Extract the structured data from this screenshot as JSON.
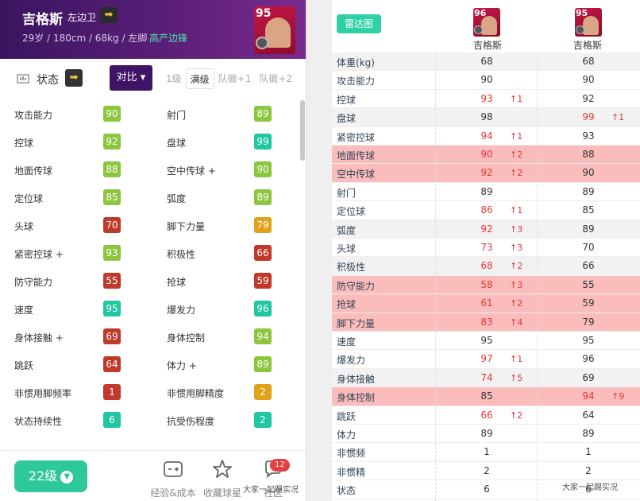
{
  "left": {
    "player_name": "吉格斯",
    "position": "左边卫",
    "info": "29岁 / 180cm / 68kg / 左脚",
    "play_style": "高产边锋",
    "card_rating": "95",
    "status_label": "状态",
    "compare_label": "对比",
    "level_tabs": [
      "1级",
      "满级",
      "队徽+1",
      "队徽+2"
    ],
    "stats": [
      {
        "label": "攻击能力",
        "value": "90",
        "color": "#8cc63f"
      },
      {
        "label": "射门",
        "value": "89",
        "color": "#8cc63f"
      },
      {
        "label": "控球",
        "value": "92",
        "color": "#8cc63f"
      },
      {
        "label": "盘球",
        "value": "99",
        "color": "#20c7a0"
      },
      {
        "label": "地面传球",
        "value": "88",
        "color": "#8cc63f"
      },
      {
        "label": "空中传球 +",
        "value": "90",
        "color": "#8cc63f"
      },
      {
        "label": "定位球",
        "value": "85",
        "color": "#8cc63f"
      },
      {
        "label": "弧度",
        "value": "89",
        "color": "#8cc63f"
      },
      {
        "label": "头球",
        "value": "70",
        "color": "#c0392b"
      },
      {
        "label": "脚下力量",
        "value": "79",
        "color": "#e2a11a"
      },
      {
        "label": "紧密控球 +",
        "value": "93",
        "color": "#8cc63f"
      },
      {
        "label": "积极性",
        "value": "66",
        "color": "#c0392b"
      },
      {
        "label": "防守能力",
        "value": "55",
        "color": "#c0392b"
      },
      {
        "label": "抢球",
        "value": "59",
        "color": "#c0392b"
      },
      {
        "label": "速度",
        "value": "95",
        "color": "#20c7a0"
      },
      {
        "label": "爆发力",
        "value": "96",
        "color": "#20c7a0"
      },
      {
        "label": "身体接触 +",
        "value": "69",
        "color": "#c0392b"
      },
      {
        "label": "身体控制",
        "value": "94",
        "color": "#8cc63f"
      },
      {
        "label": "跳跃",
        "value": "64",
        "color": "#c0392b"
      },
      {
        "label": "体力 +",
        "value": "89",
        "color": "#8cc63f"
      },
      {
        "label": "非惯用脚频率",
        "value": "1",
        "color": "#c0392b"
      },
      {
        "label": "非惯用脚精度",
        "value": "2",
        "color": "#e2a11a"
      },
      {
        "label": "状态持续性",
        "value": "6",
        "color": "#20c7a0"
      },
      {
        "label": "抗受伤程度",
        "value": "2",
        "color": "#20c7a0"
      }
    ],
    "level_button": "22级",
    "nav": [
      {
        "label": "经验&成本",
        "icon": "exp-cost-icon"
      },
      {
        "label": "收藏球星",
        "icon": "star-icon"
      },
      {
        "label": "社区",
        "icon": "chat-icon"
      }
    ],
    "notification_count": "12",
    "watermark": "大家一起踢实况"
  },
  "right": {
    "radar_label": "雷达图",
    "players": [
      {
        "name": "吉格斯",
        "rating": "96"
      },
      {
        "name": "吉格斯",
        "rating": "95"
      }
    ],
    "rows": [
      {
        "label": "体重(kg)",
        "v1": "68",
        "d1": "",
        "v2": "68",
        "d2": "",
        "style": "alt",
        "red1": false,
        "red2": false
      },
      {
        "label": "攻击能力",
        "v1": "90",
        "d1": "",
        "v2": "90",
        "d2": "",
        "style": "",
        "red1": false,
        "red2": false
      },
      {
        "label": "控球",
        "v1": "93",
        "d1": "↑1",
        "v2": "92",
        "d2": "",
        "style": "",
        "red1": true,
        "red2": false
      },
      {
        "label": "盘球",
        "v1": "98",
        "d1": "",
        "v2": "99",
        "d2": "↑1",
        "style": "alt",
        "red1": false,
        "red2": true
      },
      {
        "label": "紧密控球",
        "v1": "94",
        "d1": "↑1",
        "v2": "93",
        "d2": "",
        "style": "",
        "red1": true,
        "red2": false
      },
      {
        "label": "地面传球",
        "v1": "90",
        "d1": "↑2",
        "v2": "88",
        "d2": "",
        "style": "hl",
        "red1": true,
        "red2": false
      },
      {
        "label": "空中传球",
        "v1": "92",
        "d1": "↑2",
        "v2": "90",
        "d2": "",
        "style": "hl",
        "red1": true,
        "red2": false
      },
      {
        "label": "射门",
        "v1": "89",
        "d1": "",
        "v2": "89",
        "d2": "",
        "style": "",
        "red1": false,
        "red2": false
      },
      {
        "label": "定位球",
        "v1": "86",
        "d1": "↑1",
        "v2": "85",
        "d2": "",
        "style": "",
        "red1": true,
        "red2": false
      },
      {
        "label": "弧度",
        "v1": "92",
        "d1": "↑3",
        "v2": "89",
        "d2": "",
        "style": "alt",
        "red1": true,
        "red2": false
      },
      {
        "label": "头球",
        "v1": "73",
        "d1": "↑3",
        "v2": "70",
        "d2": "",
        "style": "",
        "red1": true,
        "red2": false
      },
      {
        "label": "积极性",
        "v1": "68",
        "d1": "↑2",
        "v2": "66",
        "d2": "",
        "style": "alt",
        "red1": true,
        "red2": false
      },
      {
        "label": "防守能力",
        "v1": "58",
        "d1": "↑3",
        "v2": "55",
        "d2": "",
        "style": "hl",
        "red1": true,
        "red2": false
      },
      {
        "label": "抢球",
        "v1": "61",
        "d1": "↑2",
        "v2": "59",
        "d2": "",
        "style": "hl",
        "red1": true,
        "red2": false
      },
      {
        "label": "脚下力量",
        "v1": "83",
        "d1": "↑4",
        "v2": "79",
        "d2": "",
        "style": "hl",
        "red1": true,
        "red2": false
      },
      {
        "label": "速度",
        "v1": "95",
        "d1": "",
        "v2": "95",
        "d2": "",
        "style": "",
        "red1": false,
        "red2": false
      },
      {
        "label": "爆发力",
        "v1": "97",
        "d1": "↑1",
        "v2": "96",
        "d2": "",
        "style": "",
        "red1": true,
        "red2": false
      },
      {
        "label": "身体接触",
        "v1": "74",
        "d1": "↑5",
        "v2": "69",
        "d2": "",
        "style": "alt",
        "red1": true,
        "red2": false
      },
      {
        "label": "身体控制",
        "v1": "85",
        "d1": "",
        "v2": "94",
        "d2": "↑9",
        "style": "hl",
        "red1": false,
        "red2": true
      },
      {
        "label": "跳跃",
        "v1": "66",
        "d1": "↑2",
        "v2": "64",
        "d2": "",
        "style": "",
        "red1": true,
        "red2": false
      },
      {
        "label": "体力",
        "v1": "89",
        "d1": "",
        "v2": "89",
        "d2": "",
        "style": "",
        "red1": false,
        "red2": false
      },
      {
        "label": "非惯频",
        "v1": "1",
        "d1": "",
        "v2": "1",
        "d2": "",
        "style": "",
        "red1": false,
        "red2": false
      },
      {
        "label": "非惯精",
        "v1": "2",
        "d1": "",
        "v2": "2",
        "d2": "",
        "style": "",
        "red1": false,
        "red2": false
      },
      {
        "label": "状态",
        "v1": "6",
        "d1": "",
        "v2": "6",
        "d2": "",
        "style": "",
        "red1": false,
        "red2": false
      }
    ],
    "watermark": "大家一起踢实况"
  }
}
